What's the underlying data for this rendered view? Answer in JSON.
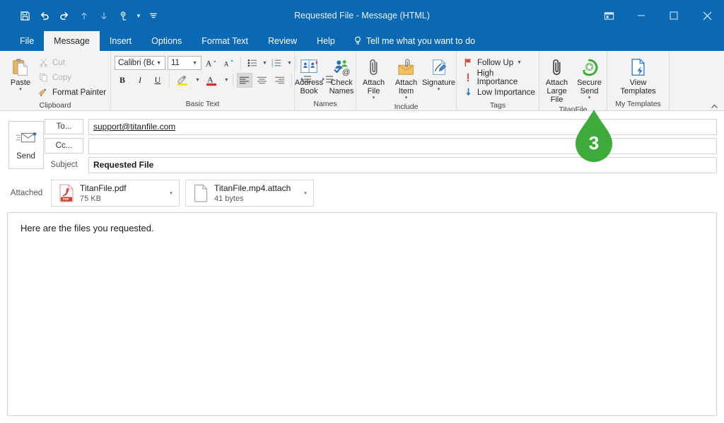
{
  "window": {
    "title": "Requested File  -  Message (HTML)",
    "controls": {
      "ribbon_display": "ribbon-display-options",
      "minimize": "minimize",
      "maximize": "maximize",
      "close": "close"
    }
  },
  "quick_access": {
    "items": [
      {
        "name": "save-icon",
        "label": "Save"
      },
      {
        "name": "undo-icon",
        "label": "Undo"
      },
      {
        "name": "redo-icon",
        "label": "Redo"
      },
      {
        "name": "previous-item-icon",
        "label": "Previous Item"
      },
      {
        "name": "next-item-icon",
        "label": "Next Item"
      },
      {
        "name": "touch-mode-icon",
        "label": "Touch/Mouse Mode"
      },
      {
        "name": "customize-qat-icon",
        "label": "Customize Quick Access Toolbar"
      }
    ]
  },
  "tabs": [
    {
      "label": "File",
      "active": false
    },
    {
      "label": "Message",
      "active": true
    },
    {
      "label": "Insert",
      "active": false
    },
    {
      "label": "Options",
      "active": false
    },
    {
      "label": "Format Text",
      "active": false
    },
    {
      "label": "Review",
      "active": false
    },
    {
      "label": "Help",
      "active": false
    }
  ],
  "tell_me": {
    "label": "Tell me what you want to do"
  },
  "ribbon": {
    "collapse_label": "Collapse the Ribbon",
    "groups": {
      "clipboard": {
        "label": "Clipboard",
        "paste": {
          "label": "Paste",
          "caret": "▾"
        },
        "cut": "Cut",
        "copy": "Copy",
        "format_painter": "Format Painter"
      },
      "basic_text": {
        "label": "Basic Text",
        "font_name": "Calibri (Bod",
        "font_size": "11",
        "grow_font": "A",
        "shrink_font": "A",
        "bold": "B",
        "italic": "I",
        "underline": "U",
        "bullets": "bullets",
        "numbering": "numbering",
        "clear_formatting": "clear-formatting",
        "highlight": "text-highlight-color",
        "font_color": "A",
        "align_left": "align-left",
        "align_center": "align-center",
        "align_right": "align-right",
        "decrease_indent": "decrease-indent",
        "increase_indent": "increase-indent"
      },
      "names": {
        "label": "Names",
        "address_book": "Address\nBook",
        "check_names": "Check\nNames"
      },
      "include": {
        "label": "Include",
        "attach_file": "Attach\nFile",
        "attach_item": "Attach\nItem",
        "signature": "Signature",
        "caret": "▾"
      },
      "tags": {
        "label": "Tags",
        "follow_up": "Follow Up",
        "high_importance": "High Importance",
        "low_importance": "Low Importance",
        "caret": "▾"
      },
      "titanfile": {
        "label": "TitanFile",
        "attach_large_file": "Attach\nLarge File",
        "secure_send": "Secure\nSend",
        "caret": "▾"
      },
      "my_templates": {
        "label": "My Templates",
        "view_templates": "View\nTemplates"
      }
    }
  },
  "compose": {
    "send_label": "Send",
    "to_button": "To...",
    "to_value": "support@titanfile.com",
    "cc_button": "Cc...",
    "cc_value": "",
    "subject_label": "Subject",
    "subject_value": "Requested File",
    "attached_label": "Attached",
    "attachments": [
      {
        "name": "TitanFile.pdf",
        "size": "75 KB",
        "icon": "pdf-file-icon",
        "caret": "▾"
      },
      {
        "name": "TitanFile.mp4.attach",
        "size": "41 bytes",
        "icon": "generic-file-icon",
        "caret": "▾"
      }
    ],
    "body_text": "Here are the files you requested."
  },
  "callout": {
    "number": "3",
    "color": "#3cab3c"
  },
  "colors": {
    "accent": "#0b68b3",
    "ribbon_bg": "#f3f3f3",
    "callout_green": "#3cab3c",
    "pdf_red": "#d83b33"
  }
}
